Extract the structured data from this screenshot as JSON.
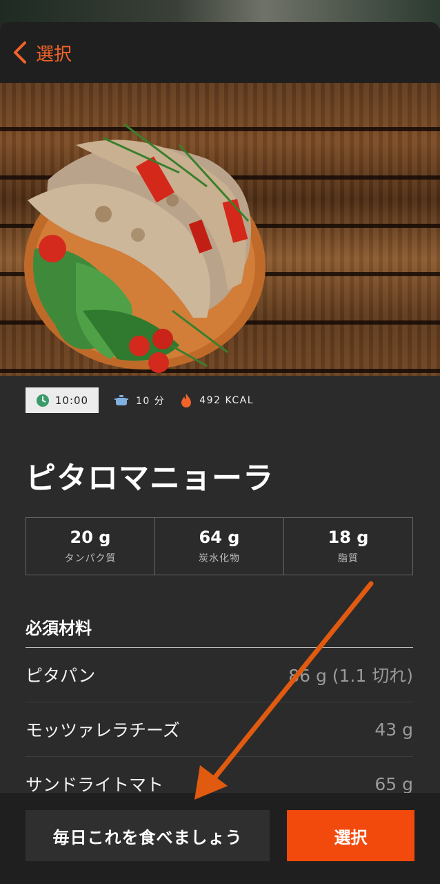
{
  "nav": {
    "back_label": "選択"
  },
  "meta": {
    "time": "10:00",
    "cook_time": "10 分",
    "calories": "492 KCAL"
  },
  "recipe": {
    "title": "ピタロマニョーラ"
  },
  "macros": [
    {
      "value": "20 g",
      "label": "タンパク質"
    },
    {
      "value": "64 g",
      "label": "炭水化物"
    },
    {
      "value": "18 g",
      "label": "脂質"
    }
  ],
  "ingredients": {
    "title": "必須材料",
    "items": [
      {
        "name": "ピタパン",
        "amount": "86 g (1.1 切れ)"
      },
      {
        "name": "モッツァレラチーズ",
        "amount": "43 g"
      },
      {
        "name": "サンドライトマト",
        "amount": "65 g"
      }
    ]
  },
  "footer": {
    "daily_label": "毎日これを食べましょう",
    "select_label": "選択"
  },
  "colors": {
    "accent": "#f2490c",
    "back": "#f2642a",
    "annotation_arrow": "#e05a10"
  },
  "icons": [
    "chevron-left-icon",
    "clock-icon",
    "pot-icon",
    "flame-icon"
  ]
}
